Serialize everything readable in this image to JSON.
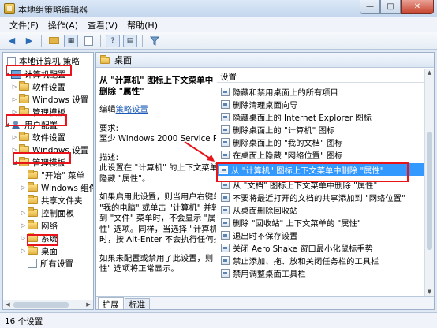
{
  "window": {
    "title": "本地组策略编辑器",
    "buttons": {
      "minimize": "—",
      "maximize": "□",
      "close": "✕"
    }
  },
  "menu": [
    "文件(F)",
    "操作(A)",
    "查看(V)",
    "帮助(H)"
  ],
  "toolbar": {
    "icons": [
      "back-arrow-icon",
      "forward-arrow-icon",
      "up-folder-icon",
      "show-tree-icon",
      "properties-icon",
      "help-icon",
      "view-icon",
      "filter-icon"
    ]
  },
  "tree": {
    "root": "本地计算机 策略",
    "items": [
      {
        "label": "计算机配置",
        "expander": "◢",
        "icon": "computer-icon"
      },
      {
        "label": "软件设置",
        "expander": "▷",
        "icon": "folder-icon"
      },
      {
        "label": "Windows 设置",
        "expander": "▷",
        "icon": "folder-icon"
      },
      {
        "label": "管理模板",
        "expander": "▷",
        "icon": "folder-icon"
      },
      {
        "label": "用户配置",
        "expander": "◢",
        "icon": "user-icon"
      },
      {
        "label": "软件设置",
        "expander": "▷",
        "icon": "folder-icon"
      },
      {
        "label": "Windows 设置",
        "expander": "▷",
        "icon": "folder-icon"
      },
      {
        "label": "管理模板",
        "expander": "◢",
        "icon": "folder-icon"
      },
      {
        "label": "\"开始\" 菜单",
        "expander": "",
        "icon": "folder-icon"
      },
      {
        "label": "Windows 组件",
        "expander": "▷",
        "icon": "folder-icon"
      },
      {
        "label": "共享文件夹",
        "expander": "",
        "icon": "folder-icon"
      },
      {
        "label": "控制面板",
        "expander": "▷",
        "icon": "folder-icon"
      },
      {
        "label": "网络",
        "expander": "▷",
        "icon": "folder-icon"
      },
      {
        "label": "系统",
        "expander": "▷",
        "icon": "folder-icon"
      },
      {
        "label": "桌面",
        "expander": "▷",
        "icon": "folder-icon"
      },
      {
        "label": "所有设置",
        "expander": "",
        "icon": "doc-icon"
      }
    ]
  },
  "header": {
    "label": "桌面"
  },
  "description": {
    "title": "从 \"计算机\" 图标上下文菜单中删除 \"属性\"",
    "edit_prefix": "编辑",
    "edit_link": "策略设置",
    "req_label": "要求:",
    "req_value": "至少 Windows 2000 Service Pack 3",
    "desc_label": "描述:",
    "desc_lines": [
      "此设置在 \"计算机\" 的上下文菜单中",
      "隐藏 \"属性\"。"
    ],
    "p2_lines": [
      "如果启用此设置，则当用户右键单击",
      "\"我的电脑\" 或单击 \"计算机\" 并转",
      "到 \"文件\" 菜单时，不会显示 \"属",
      "性\" 选项。同样，当选择 \"计算机\"",
      "时，按 Alt-Enter 不会执行任何操作。"
    ],
    "p3_lines": [
      "如果未配置或禁用了此设置，则 \"属",
      "性\" 选项将正常显示。"
    ]
  },
  "list": {
    "column": "设置",
    "rows": [
      "隐藏和禁用桌面上的所有项目",
      "删除清理桌面向导",
      "隐藏桌面上的 Internet Explorer 图标",
      "删除桌面上的 \"计算机\" 图标",
      "删除桌面上的 \"我的文档\" 图标",
      "在桌面上隐藏 \"网络位置\" 图标",
      "从 \"计算机\" 图标上下文菜单中删除 \"属性\"",
      "从 \"文档\" 图标上下文菜单中删除 \"属性\"",
      "不要将最近打开的文档的共享添加到 \"网络位置\"",
      "从桌面删除回收站",
      "删除 \"回收站\" 上下文菜单的 \"属性\"",
      "退出时不保存设置",
      "关闭 Aero Shake 窗口最小化鼠标手势",
      "禁止添加、拖、放和关闭任务栏的工具栏",
      "禁用调整桌面工具栏"
    ],
    "selected_index": 6
  },
  "tabs": {
    "extended": "扩展",
    "standard": "标准"
  },
  "status": {
    "text": "16 个设置"
  },
  "annotation_color": "#e8141a"
}
